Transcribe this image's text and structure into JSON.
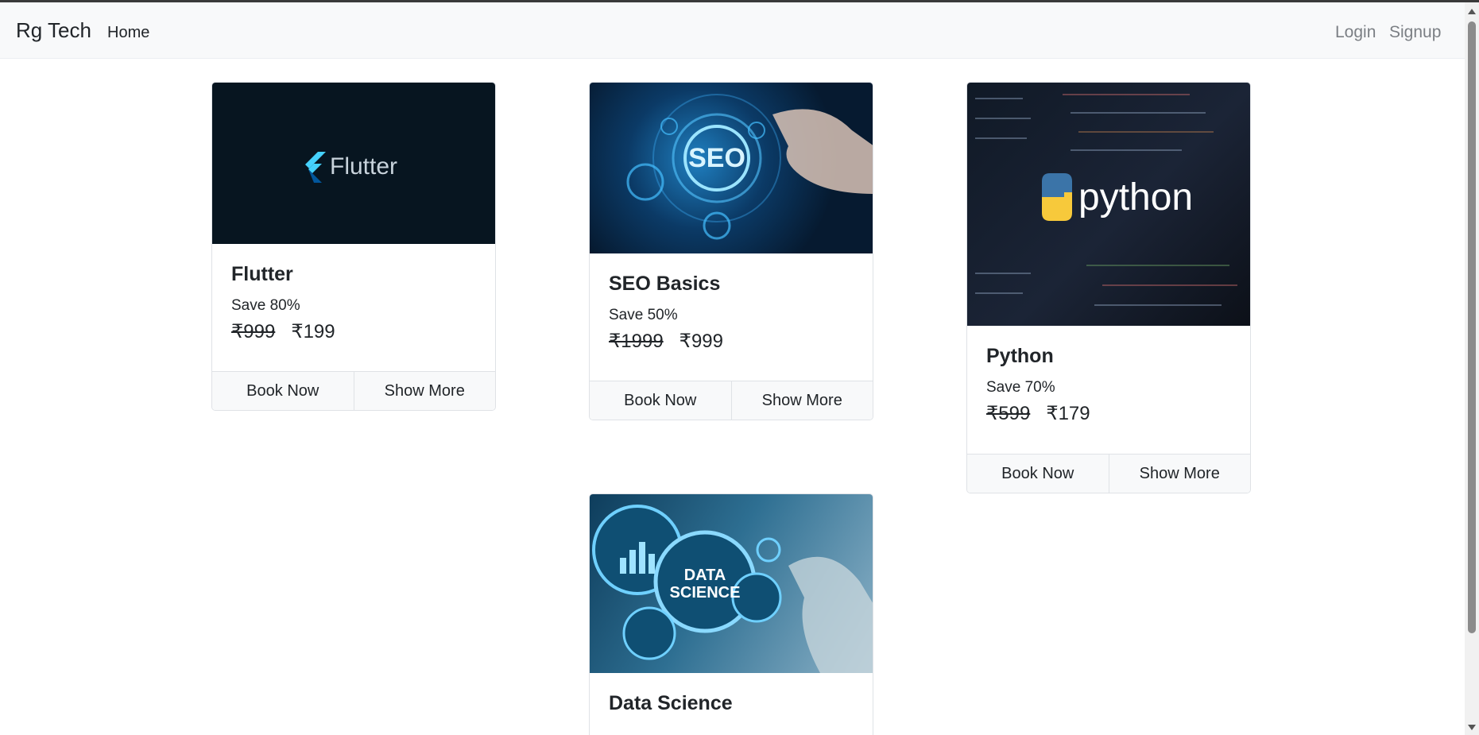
{
  "navbar": {
    "brand": "Rg Tech",
    "home": "Home",
    "login": "Login",
    "signup": "Signup"
  },
  "courses": [
    {
      "title": "Flutter",
      "save": "Save 80%",
      "old_price": "₹999",
      "price": "₹199",
      "book": "Book Now",
      "more": "Show More",
      "image_text": "Flutter"
    },
    {
      "title": "SEO Basics",
      "save": "Save 50%",
      "old_price": "₹1999",
      "price": "₹999",
      "book": "Book Now",
      "more": "Show More",
      "image_text": "SEO"
    },
    {
      "title": "Python",
      "save": "Save 70%",
      "old_price": "₹599",
      "price": "₹179",
      "book": "Book Now",
      "more": "Show More",
      "image_text": "python"
    },
    {
      "title": "Data Science",
      "image_text_1": "DATA",
      "image_text_2": "SCIENCE"
    }
  ],
  "colors": {
    "navbar_bg": "#f8f9fa",
    "text": "#212529",
    "muted_link": "#7b7f84",
    "flutter_bg": "#071520",
    "flutter_blue": "#45d1fd"
  }
}
